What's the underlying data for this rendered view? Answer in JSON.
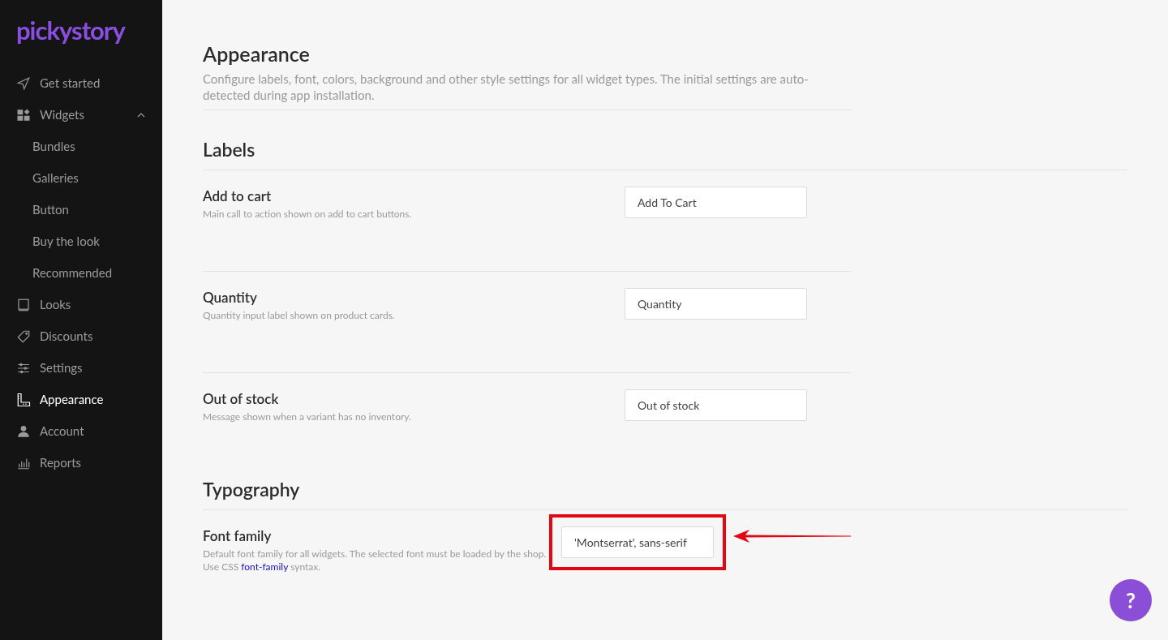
{
  "sidebar": {
    "logo": "pickystory",
    "items": [
      {
        "label": "Get started",
        "selected": false
      },
      {
        "label": "Widgets",
        "selected": false,
        "expanded": true,
        "children": [
          {
            "label": "Bundles",
            "selected": false
          },
          {
            "label": "Galleries",
            "selected": false
          },
          {
            "label": "Button",
            "selected": false
          },
          {
            "label": "Buy the look",
            "selected": false
          },
          {
            "label": "Recommended",
            "selected": false
          }
        ]
      },
      {
        "label": "Looks",
        "selected": false
      },
      {
        "label": "Discounts",
        "selected": false
      },
      {
        "label": "Settings",
        "selected": false
      },
      {
        "label": "Appearance",
        "selected": true
      },
      {
        "label": "Account",
        "selected": false
      },
      {
        "label": "Reports",
        "selected": false
      }
    ]
  },
  "page": {
    "title": "Appearance",
    "description": "Configure labels, font, colors, background and other style settings for all widget types. The initial settings are auto-detected during app installation."
  },
  "sections": [
    {
      "title": "Labels",
      "rows": [
        {
          "title": "Add to cart",
          "description": [
            {
              "kind": "text",
              "text": "Main call to action shown on add to cart buttons."
            }
          ],
          "value": "Add To Cart",
          "highlighted": false
        },
        {
          "title": "Quantity",
          "description": [
            {
              "kind": "text",
              "text": "Quantity input label shown on product cards."
            }
          ],
          "value": "Quantity",
          "highlighted": false
        },
        {
          "title": "Out of stock",
          "description": [
            {
              "kind": "text",
              "text": "Message shown when a variant has no inventory."
            }
          ],
          "value": "Out of stock",
          "highlighted": false
        }
      ]
    },
    {
      "title": "Typography",
      "rows": [
        {
          "title": "Font family",
          "description": [
            {
              "kind": "text",
              "text": "Default font family for all widgets. The selected font must be loaded by the shop. Use CSS "
            },
            {
              "kind": "link",
              "text": "font-family"
            },
            {
              "kind": "text",
              "text": " syntax."
            }
          ],
          "value": "'Montserrat', sans-serif",
          "highlighted": true
        }
      ]
    }
  ],
  "help_button": {
    "label": "?"
  }
}
